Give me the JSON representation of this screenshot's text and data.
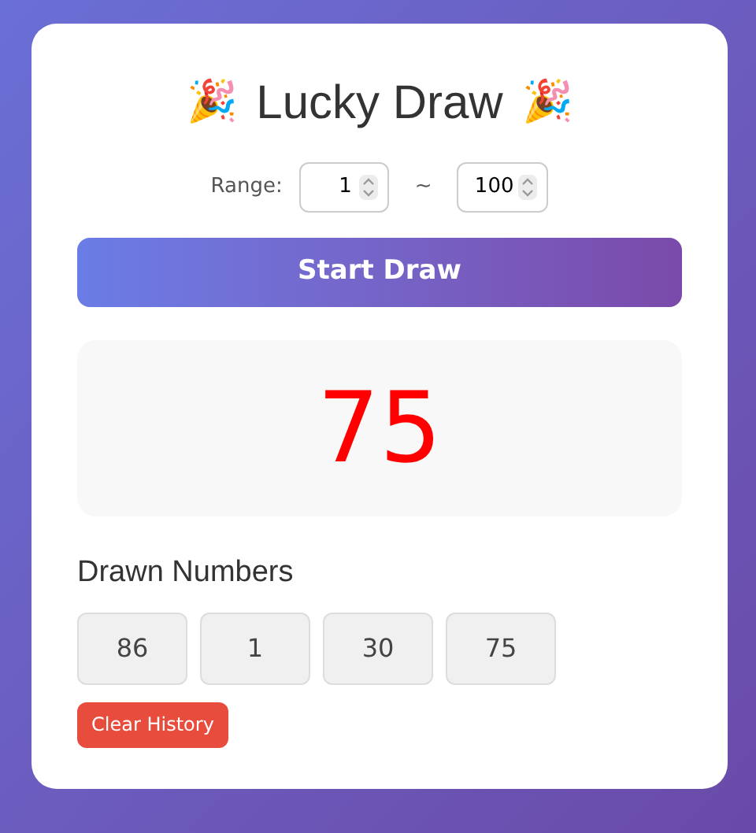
{
  "title": {
    "icon_left": "🎉",
    "text": "Lucky Draw",
    "icon_right": "🎉"
  },
  "range": {
    "label": "Range:",
    "min": "1",
    "separator": "~",
    "max": "100"
  },
  "draw_button": "Start Draw",
  "result": "75",
  "history": {
    "heading": "Drawn Numbers",
    "numbers": [
      "86",
      "1",
      "30",
      "75"
    ]
  },
  "clear_button": "Clear History"
}
